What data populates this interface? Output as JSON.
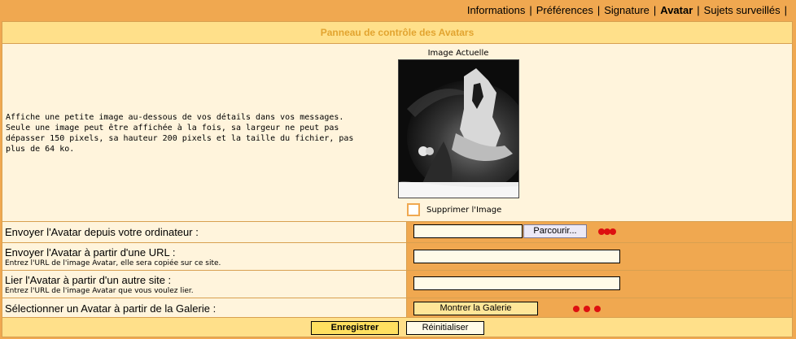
{
  "nav": {
    "items": [
      {
        "label": "Informations",
        "active": false
      },
      {
        "label": "Préférences",
        "active": false
      },
      {
        "label": "Signature",
        "active": false
      },
      {
        "label": "Avatar",
        "active": true
      },
      {
        "label": "Sujets surveillés",
        "active": false
      }
    ],
    "separator": "|"
  },
  "panel": {
    "title": "Panneau de contrôle des Avatars"
  },
  "avatar": {
    "description": "Affiche une petite image au-dessous de vos détails dans vos messages. Seule une image peut être affichée à la fois, sa largeur ne peut pas dépasser 150 pixels, sa hauteur 200 pixels et la taille du fichier, pas plus de 64 ko.",
    "current_label": "Image Actuelle",
    "delete_label": "Supprimer l'Image"
  },
  "upload": {
    "label": "Envoyer l'Avatar depuis votre ordinateur :",
    "browse_label": "Parcourir...",
    "value": ""
  },
  "url_upload": {
    "label": "Envoyer l'Avatar à partir d'une URL :",
    "hint": "Entrez l'URL de l'image Avatar, elle sera copiée sur ce site.",
    "value": ""
  },
  "link": {
    "label": "Lier l'Avatar à partir d'un autre site :",
    "hint": "Entrez l'URL de l'image Avatar que vous voulez lier.",
    "value": ""
  },
  "gallery": {
    "label": "Sélectionner un Avatar à partir de la Galerie :",
    "button_label": "Montrer la Galerie"
  },
  "actions": {
    "submit_label": "Enregistrer",
    "reset_label": "Réinitialiser"
  },
  "colors": {
    "page_bg": "#f0a850",
    "panel_bg": "#fff4dc",
    "header_bg": "#ffe08a",
    "header_text": "#e2a430",
    "annotation_dots": "#dd1010"
  }
}
